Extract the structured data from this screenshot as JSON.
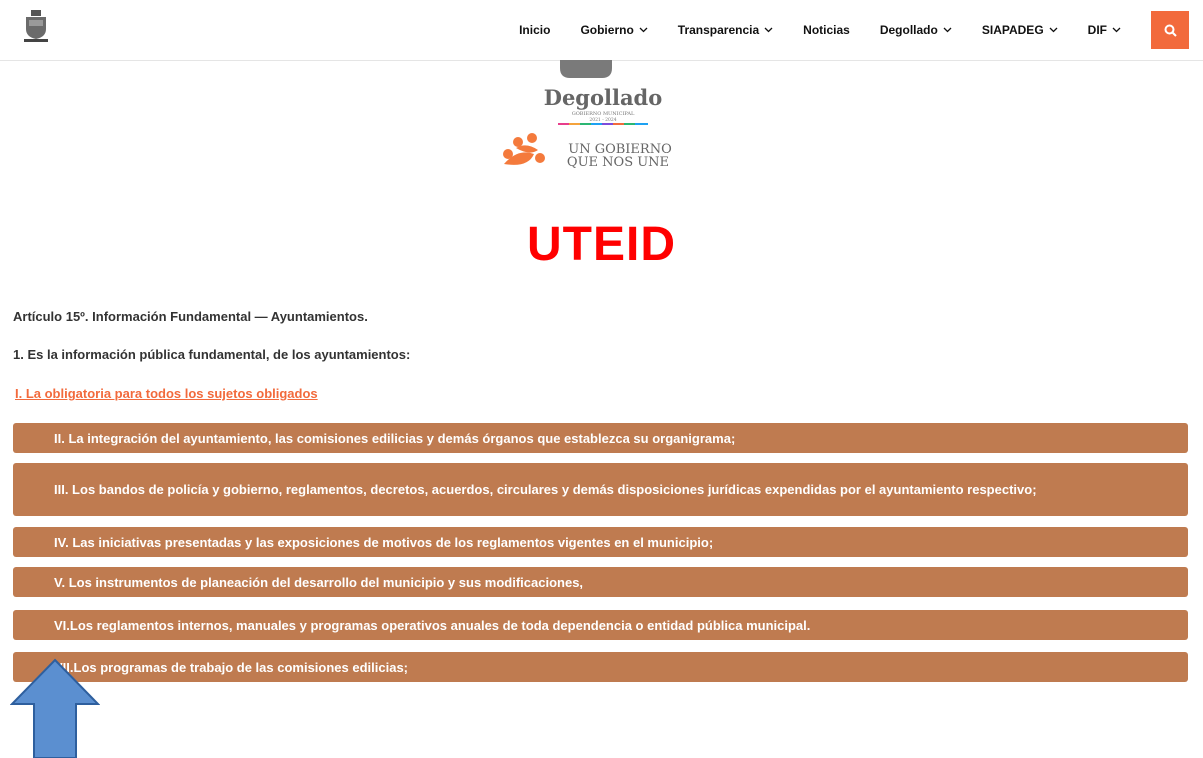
{
  "nav": {
    "items": [
      {
        "label": "Inicio",
        "dropdown": false
      },
      {
        "label": "Gobierno",
        "dropdown": true
      },
      {
        "label": "Transparencia",
        "dropdown": true
      },
      {
        "label": "Noticias",
        "dropdown": false
      },
      {
        "label": "Degollado",
        "dropdown": true
      },
      {
        "label": "SIAPADEG",
        "dropdown": true
      },
      {
        "label": "DIF",
        "dropdown": true
      }
    ],
    "search_icon": "search-icon",
    "accent_color": "#f26a3c"
  },
  "hero": {
    "logo_name": "Degollado",
    "logo_subtitle": "GOBIERNO MUNICIPAL",
    "logo_years": "2021 - 2024",
    "slogan_line1": "UN GOBIERNO",
    "slogan_line2": "QUE NOS UNE"
  },
  "page": {
    "title": "UTEID",
    "title_color": "#ff0000",
    "intro_1": "Artículo 15º. Información Fundamental — Ayuntamientos.",
    "intro_2": "1. Es la información pública fundamental, de los ayuntamientos:",
    "link_1": "I. La obligatoria para todos los sujetos obligados"
  },
  "accordion": {
    "color": "#bf7b50",
    "items": [
      {
        "label": "II. La integración del ayuntamiento, las comisiones edilicias y demás órganos que establezca su organigrama;"
      },
      {
        "label": "III. Los bandos de policía y gobierno, reglamentos, decretos, acuerdos, circulares y demás disposiciones jurídicas expendidas por el ayuntamiento respectivo;"
      },
      {
        "label": "IV. Las iniciativas presentadas y las exposiciones de motivos de los reglamentos vigentes en el municipio;"
      },
      {
        "label": "V. Los instrumentos de planeación del desarrollo del municipio y sus modificaciones,"
      },
      {
        "label": "VI.Los reglamentos internos, manuales y programas operativos anuales de toda dependencia o entidad pública municipal."
      },
      {
        "label": "VII.Los programas de trabajo de las comisiones edilicias;"
      }
    ]
  },
  "annotation": {
    "arrow_icon": "up-arrow-icon",
    "color": "#5b8fd0"
  }
}
